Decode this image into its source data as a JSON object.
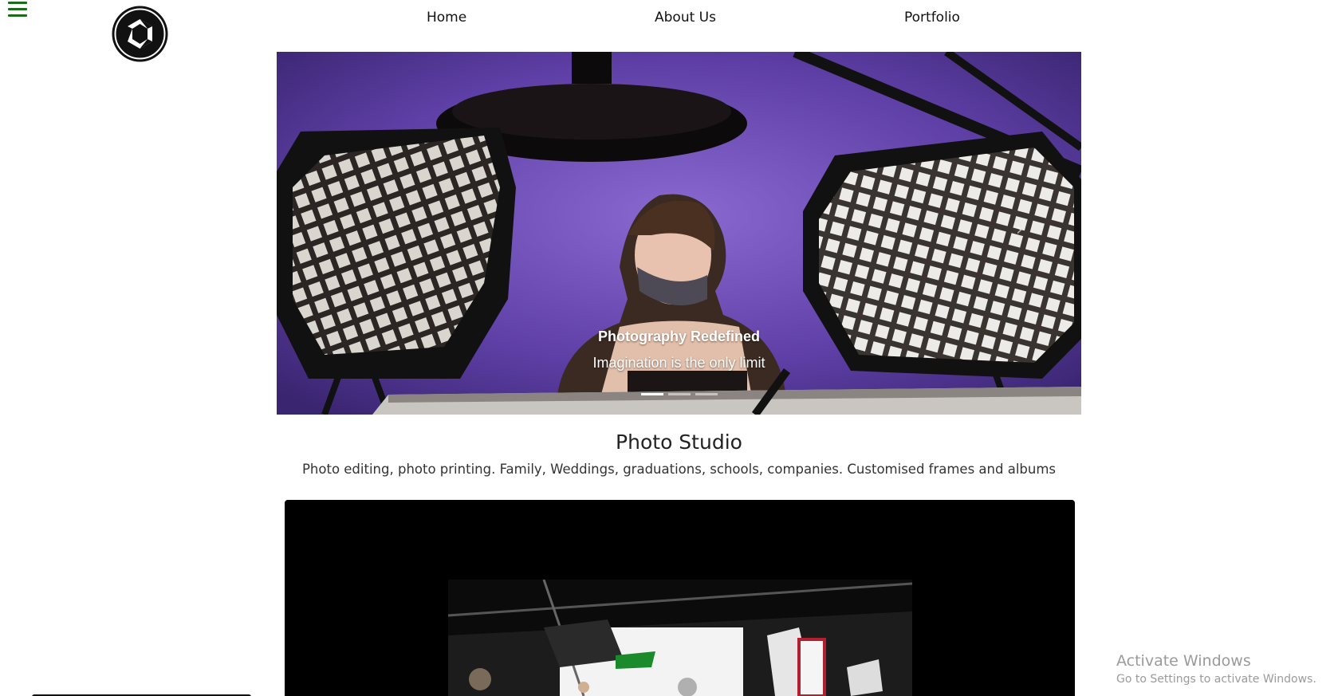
{
  "nav": {
    "items": [
      {
        "label": "Home"
      },
      {
        "label": "About Us"
      },
      {
        "label": "Portfolio"
      }
    ]
  },
  "icons": {
    "menu": "hamburger-menu-icon",
    "logo": "camera-shutter-logo",
    "next": "chevron-right-icon"
  },
  "carousel": {
    "title": "Photography Redefined",
    "subtitle": "Imagination is the only limit",
    "slide_count": 3,
    "active_slide": 1
  },
  "studio": {
    "title": "Photo Studio",
    "description": "Photo editing, photo printing. Family, Weddings, graduations, schools, companies. Customised frames and albums"
  },
  "windows_watermark": {
    "line1": "Activate Windows",
    "line2": "Go to Settings to activate Windows."
  },
  "colors": {
    "menu_icon": "#1a6b1a",
    "carousel_bg": "#5b3f9e",
    "video_bg": "#000000",
    "watermark": "#9a9a9a"
  }
}
